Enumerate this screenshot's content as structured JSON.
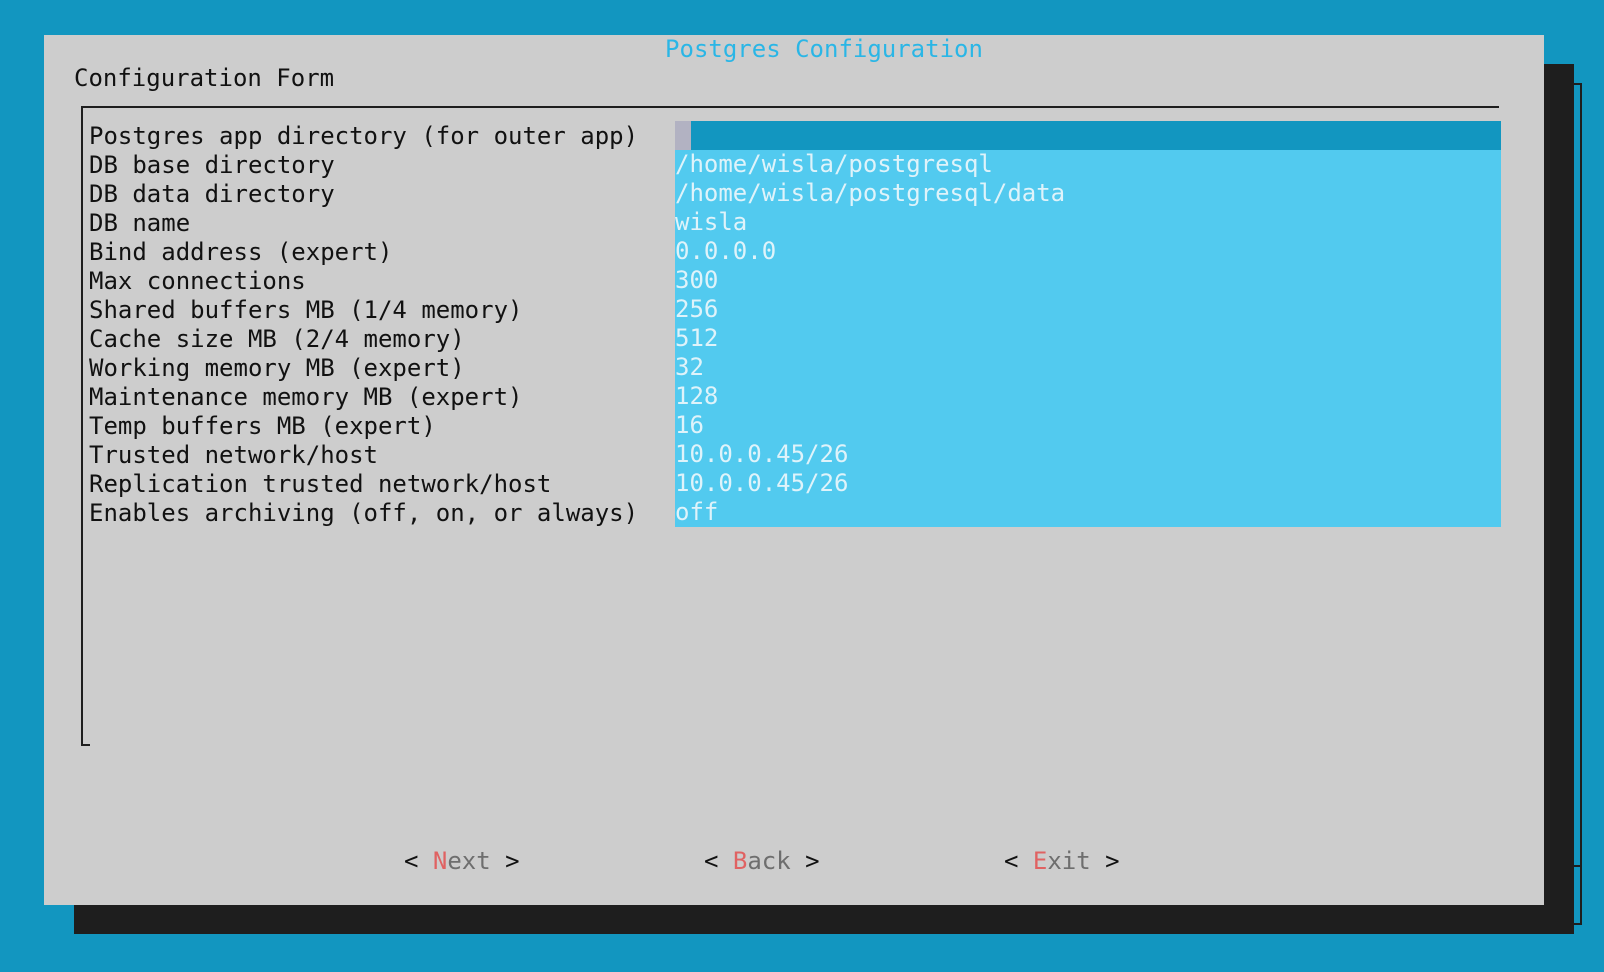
{
  "dialog": {
    "title": "Postgres Configuration",
    "form_label": "Configuration Form"
  },
  "fields": [
    {
      "label": "Postgres app directory (for outer app)",
      "value": ""
    },
    {
      "label": "DB base directory",
      "value": "/home/wisla/postgresql"
    },
    {
      "label": "DB data directory",
      "value": "/home/wisla/postgresql/data"
    },
    {
      "label": "DB name",
      "value": "wisla"
    },
    {
      "label": "Bind address (expert)",
      "value": "0.0.0.0"
    },
    {
      "label": "Max connections",
      "value": "300"
    },
    {
      "label": "Shared buffers MB (1/4 memory)",
      "value": "256"
    },
    {
      "label": "Cache size MB (2/4 memory)",
      "value": "512"
    },
    {
      "label": "Working memory MB (expert)",
      "value": "32"
    },
    {
      "label": "Maintenance memory MB (expert)",
      "value": "128"
    },
    {
      "label": "Temp buffers MB (expert)",
      "value": "16"
    },
    {
      "label": "Trusted network/host",
      "value": "10.0.0.45/26"
    },
    {
      "label": "Replication trusted network/host",
      "value": "10.0.0.45/26"
    },
    {
      "label": "Enables archiving (off, on, or always)",
      "value": "off"
    }
  ],
  "buttons": {
    "next": {
      "open": "< ",
      "hotkey": "N",
      "rest": "ext",
      "close": " >"
    },
    "back": {
      "open": "< ",
      "hotkey": "B",
      "rest": "ack",
      "close": " >"
    },
    "exit": {
      "open": "< ",
      "hotkey": "E",
      "rest": "xit",
      "close": " >"
    }
  },
  "colors": {
    "background": "#1296c0",
    "dialog": "#cdcdcd",
    "title": "#2ab6e6",
    "field": "#52caef",
    "field_focused": "#1296c0",
    "hotkey": "#e06262"
  }
}
